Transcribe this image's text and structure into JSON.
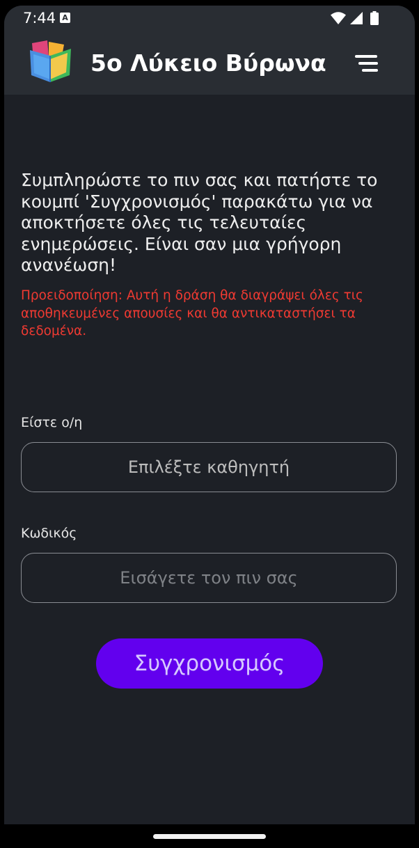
{
  "status_bar": {
    "time": "7:44",
    "notification_icon": "font-a-icon",
    "right_icons": [
      "wifi-icon",
      "signal-icon",
      "battery-icon"
    ]
  },
  "app_bar": {
    "title": "5ο Λύκειο Βύρωνα",
    "logo_icon": "open-book-logo",
    "menu_icon": "menu-icon"
  },
  "main": {
    "intro_text": "Συμπληρώστε το πιν σας και πατήστε το κουμπί 'Συγχρονισμός' παρακάτω για να αποκτήσετε όλες τις τελευταίες ενημερώσεις. Είναι σαν μια γρήγορη ανανέωση!",
    "warning_text": "Προειδοποίηση: Αυτή η δράση θα διαγράψει όλες τις αποθηκευμένες απουσίες και θα αντικαταστήσει τα δεδομένα.",
    "teacher_field": {
      "label": "Είστε ο/η",
      "placeholder": "Επιλέξτε καθηγητή"
    },
    "code_field": {
      "label": "Κωδικός",
      "placeholder": "Εισάγετε τον πιν σας"
    },
    "sync_button_label": "Συγχρονισμός"
  },
  "colors": {
    "background": "#1d2026",
    "app_bar": "#292d33",
    "accent": "#6200ee",
    "warning": "#ef3a32"
  }
}
